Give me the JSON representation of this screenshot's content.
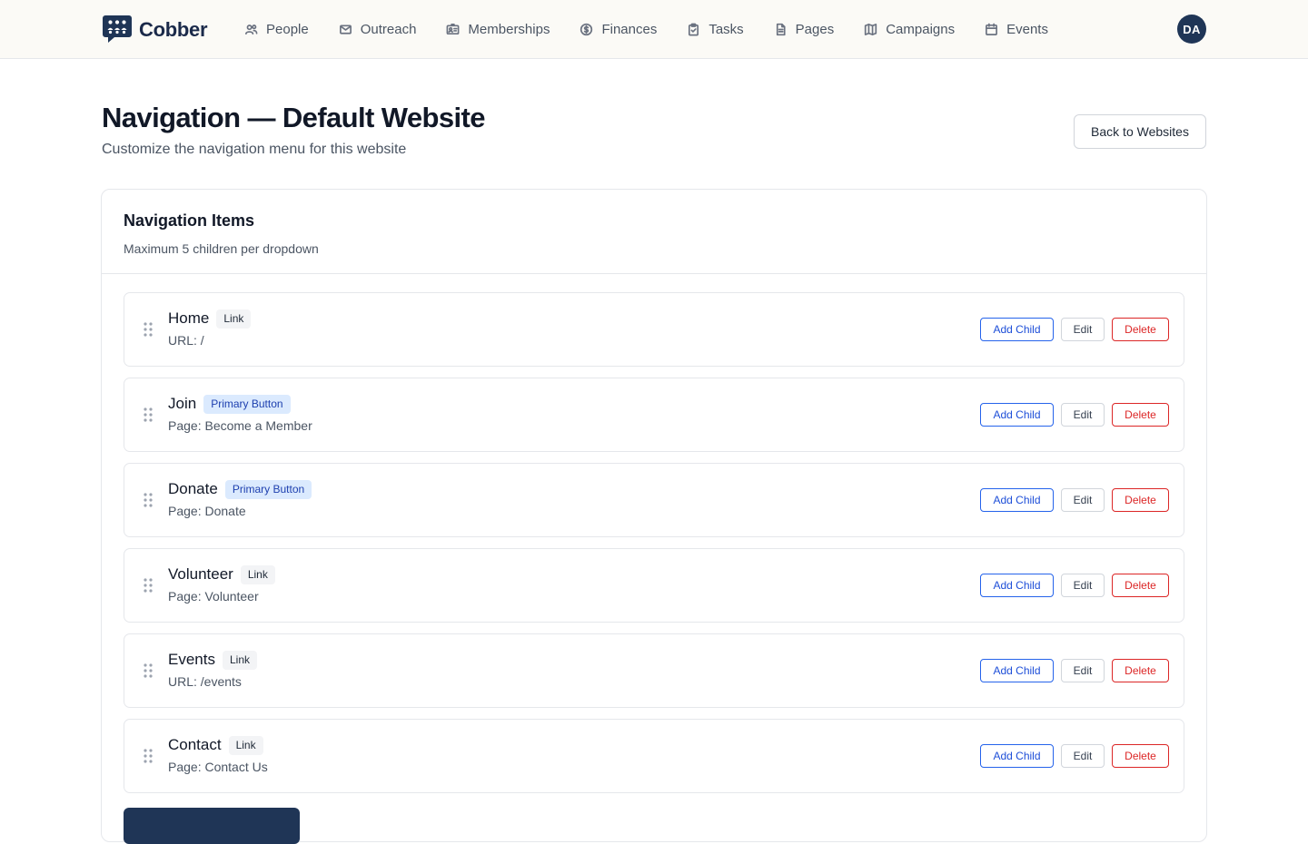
{
  "app": {
    "brand": "Cobber",
    "user_initials": "DA"
  },
  "nav": [
    {
      "label": "People",
      "icon": "people-icon"
    },
    {
      "label": "Outreach",
      "icon": "mail-icon"
    },
    {
      "label": "Memberships",
      "icon": "id-card-icon"
    },
    {
      "label": "Finances",
      "icon": "dollar-circle-icon"
    },
    {
      "label": "Tasks",
      "icon": "clipboard-check-icon"
    },
    {
      "label": "Pages",
      "icon": "document-icon"
    },
    {
      "label": "Campaigns",
      "icon": "map-icon"
    },
    {
      "label": "Events",
      "icon": "calendar-icon"
    }
  ],
  "page": {
    "title": "Navigation — Default Website",
    "subtitle": "Customize the navigation menu for this website",
    "back_label": "Back to Websites"
  },
  "card": {
    "title": "Navigation Items",
    "description": "Maximum 5 children per dropdown"
  },
  "items": [
    {
      "label": "Home",
      "badge": "Link",
      "badge_kind": "link",
      "target": "URL: /"
    },
    {
      "label": "Join",
      "badge": "Primary Button",
      "badge_kind": "primary",
      "target": "Page: Become a Member"
    },
    {
      "label": "Donate",
      "badge": "Primary Button",
      "badge_kind": "primary",
      "target": "Page: Donate"
    },
    {
      "label": "Volunteer",
      "badge": "Link",
      "badge_kind": "link",
      "target": "Page: Volunteer"
    },
    {
      "label": "Events",
      "badge": "Link",
      "badge_kind": "link",
      "target": "URL: /events"
    },
    {
      "label": "Contact",
      "badge": "Link",
      "badge_kind": "link",
      "target": "Page: Contact Us"
    }
  ],
  "actions": {
    "add_child": "Add Child",
    "edit": "Edit",
    "delete": "Delete"
  },
  "colors": {
    "brand_navy": "#1f3556",
    "accent_blue": "#2563eb",
    "danger_red": "#dc2626",
    "header_bg": "#fbfaf6"
  }
}
